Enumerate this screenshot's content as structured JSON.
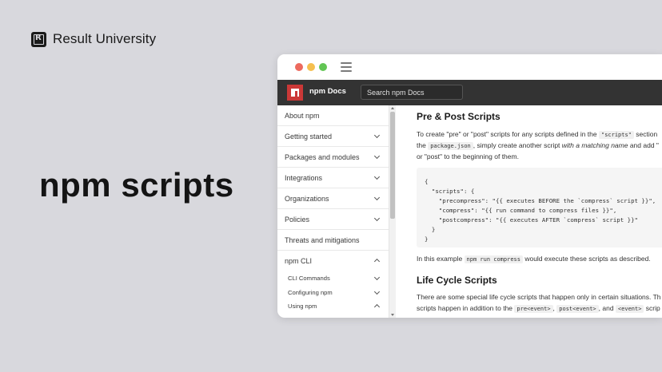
{
  "brand": {
    "logo_letter": "R",
    "name": "Result University"
  },
  "hero_title": "npm scripts",
  "browser": {
    "topnav": {
      "site_title": "npm Docs",
      "search_placeholder": "Search npm Docs"
    }
  },
  "sidebar": {
    "items": [
      {
        "label": "About npm",
        "chevron": "none"
      },
      {
        "label": "Getting started",
        "chevron": "down"
      },
      {
        "label": "Packages and modules",
        "chevron": "down"
      },
      {
        "label": "Integrations",
        "chevron": "down"
      },
      {
        "label": "Organizations",
        "chevron": "down"
      },
      {
        "label": "Policies",
        "chevron": "down"
      },
      {
        "label": "Threats and mitigations",
        "chevron": "none"
      },
      {
        "label": "npm CLI",
        "chevron": "up"
      }
    ],
    "subitems": [
      {
        "label": "CLI Commands",
        "chevron": "down"
      },
      {
        "label": "Configuring npm",
        "chevron": "down"
      },
      {
        "label": "Using npm",
        "chevron": "up"
      }
    ]
  },
  "content": {
    "h1": "Pre & Post Scripts",
    "p1": {
      "a": "To create \"pre\" or \"post\" scripts for any scripts defined in the ",
      "code1": "\"scripts\"",
      "b": " section",
      "c": "the ",
      "code2": "package.json",
      "d": ", simply create another script ",
      "em": "with a matching name",
      "e": " and add \"",
      "f": "or \"post\" to the beginning of them."
    },
    "code_lines": [
      "{",
      "  \"scripts\": {",
      "    \"precompress\": \"{{ executes BEFORE the `compress` script }}\",",
      "    \"compress\": \"{{ run command to compress files }}\",",
      "    \"postcompress\": \"{{ executes AFTER `compress` script }}\"",
      "  }",
      "}"
    ],
    "p2": {
      "a": "In this example ",
      "code": "npm run compress",
      "b": " would execute these scripts as described."
    },
    "h2": "Life Cycle Scripts",
    "p3": {
      "a": "There are some special life cycle scripts that happen only in certain situations. Th",
      "b": "scripts happen in addition to the ",
      "code1": "pre<event>",
      "c": ", ",
      "code2": "post<event>",
      "d": ", and ",
      "code3": "<event>",
      "e": " scrip"
    }
  }
}
